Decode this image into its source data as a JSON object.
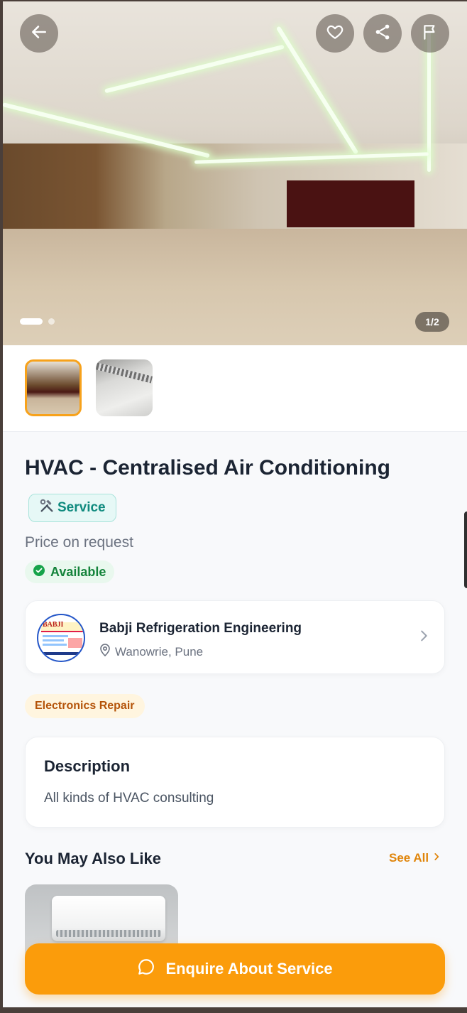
{
  "gallery": {
    "counter": "1/2",
    "active_index": 0,
    "total": 2
  },
  "listing": {
    "title": "HVAC - Centralised Air Conditioning",
    "type_badge": "Service",
    "type_badge_icon": "hammer-wrench-icon",
    "price": "Price on request",
    "availability": "Available"
  },
  "seller": {
    "name": "Babji Refrigeration Engineering",
    "location": "Wanowrie, Pune",
    "logo_text": "BABJI"
  },
  "category_tag": "Electronics Repair",
  "description": {
    "heading": "Description",
    "text": "All kinds of HVAC consulting"
  },
  "recommendations": {
    "heading": "You May Also Like",
    "see_all": "See All"
  },
  "cta": {
    "label": "Enquire About Service"
  },
  "colors": {
    "accent": "#fb9c0b",
    "service_badge": "#0f8a7e",
    "available": "#14833b",
    "category": "#b45309"
  }
}
